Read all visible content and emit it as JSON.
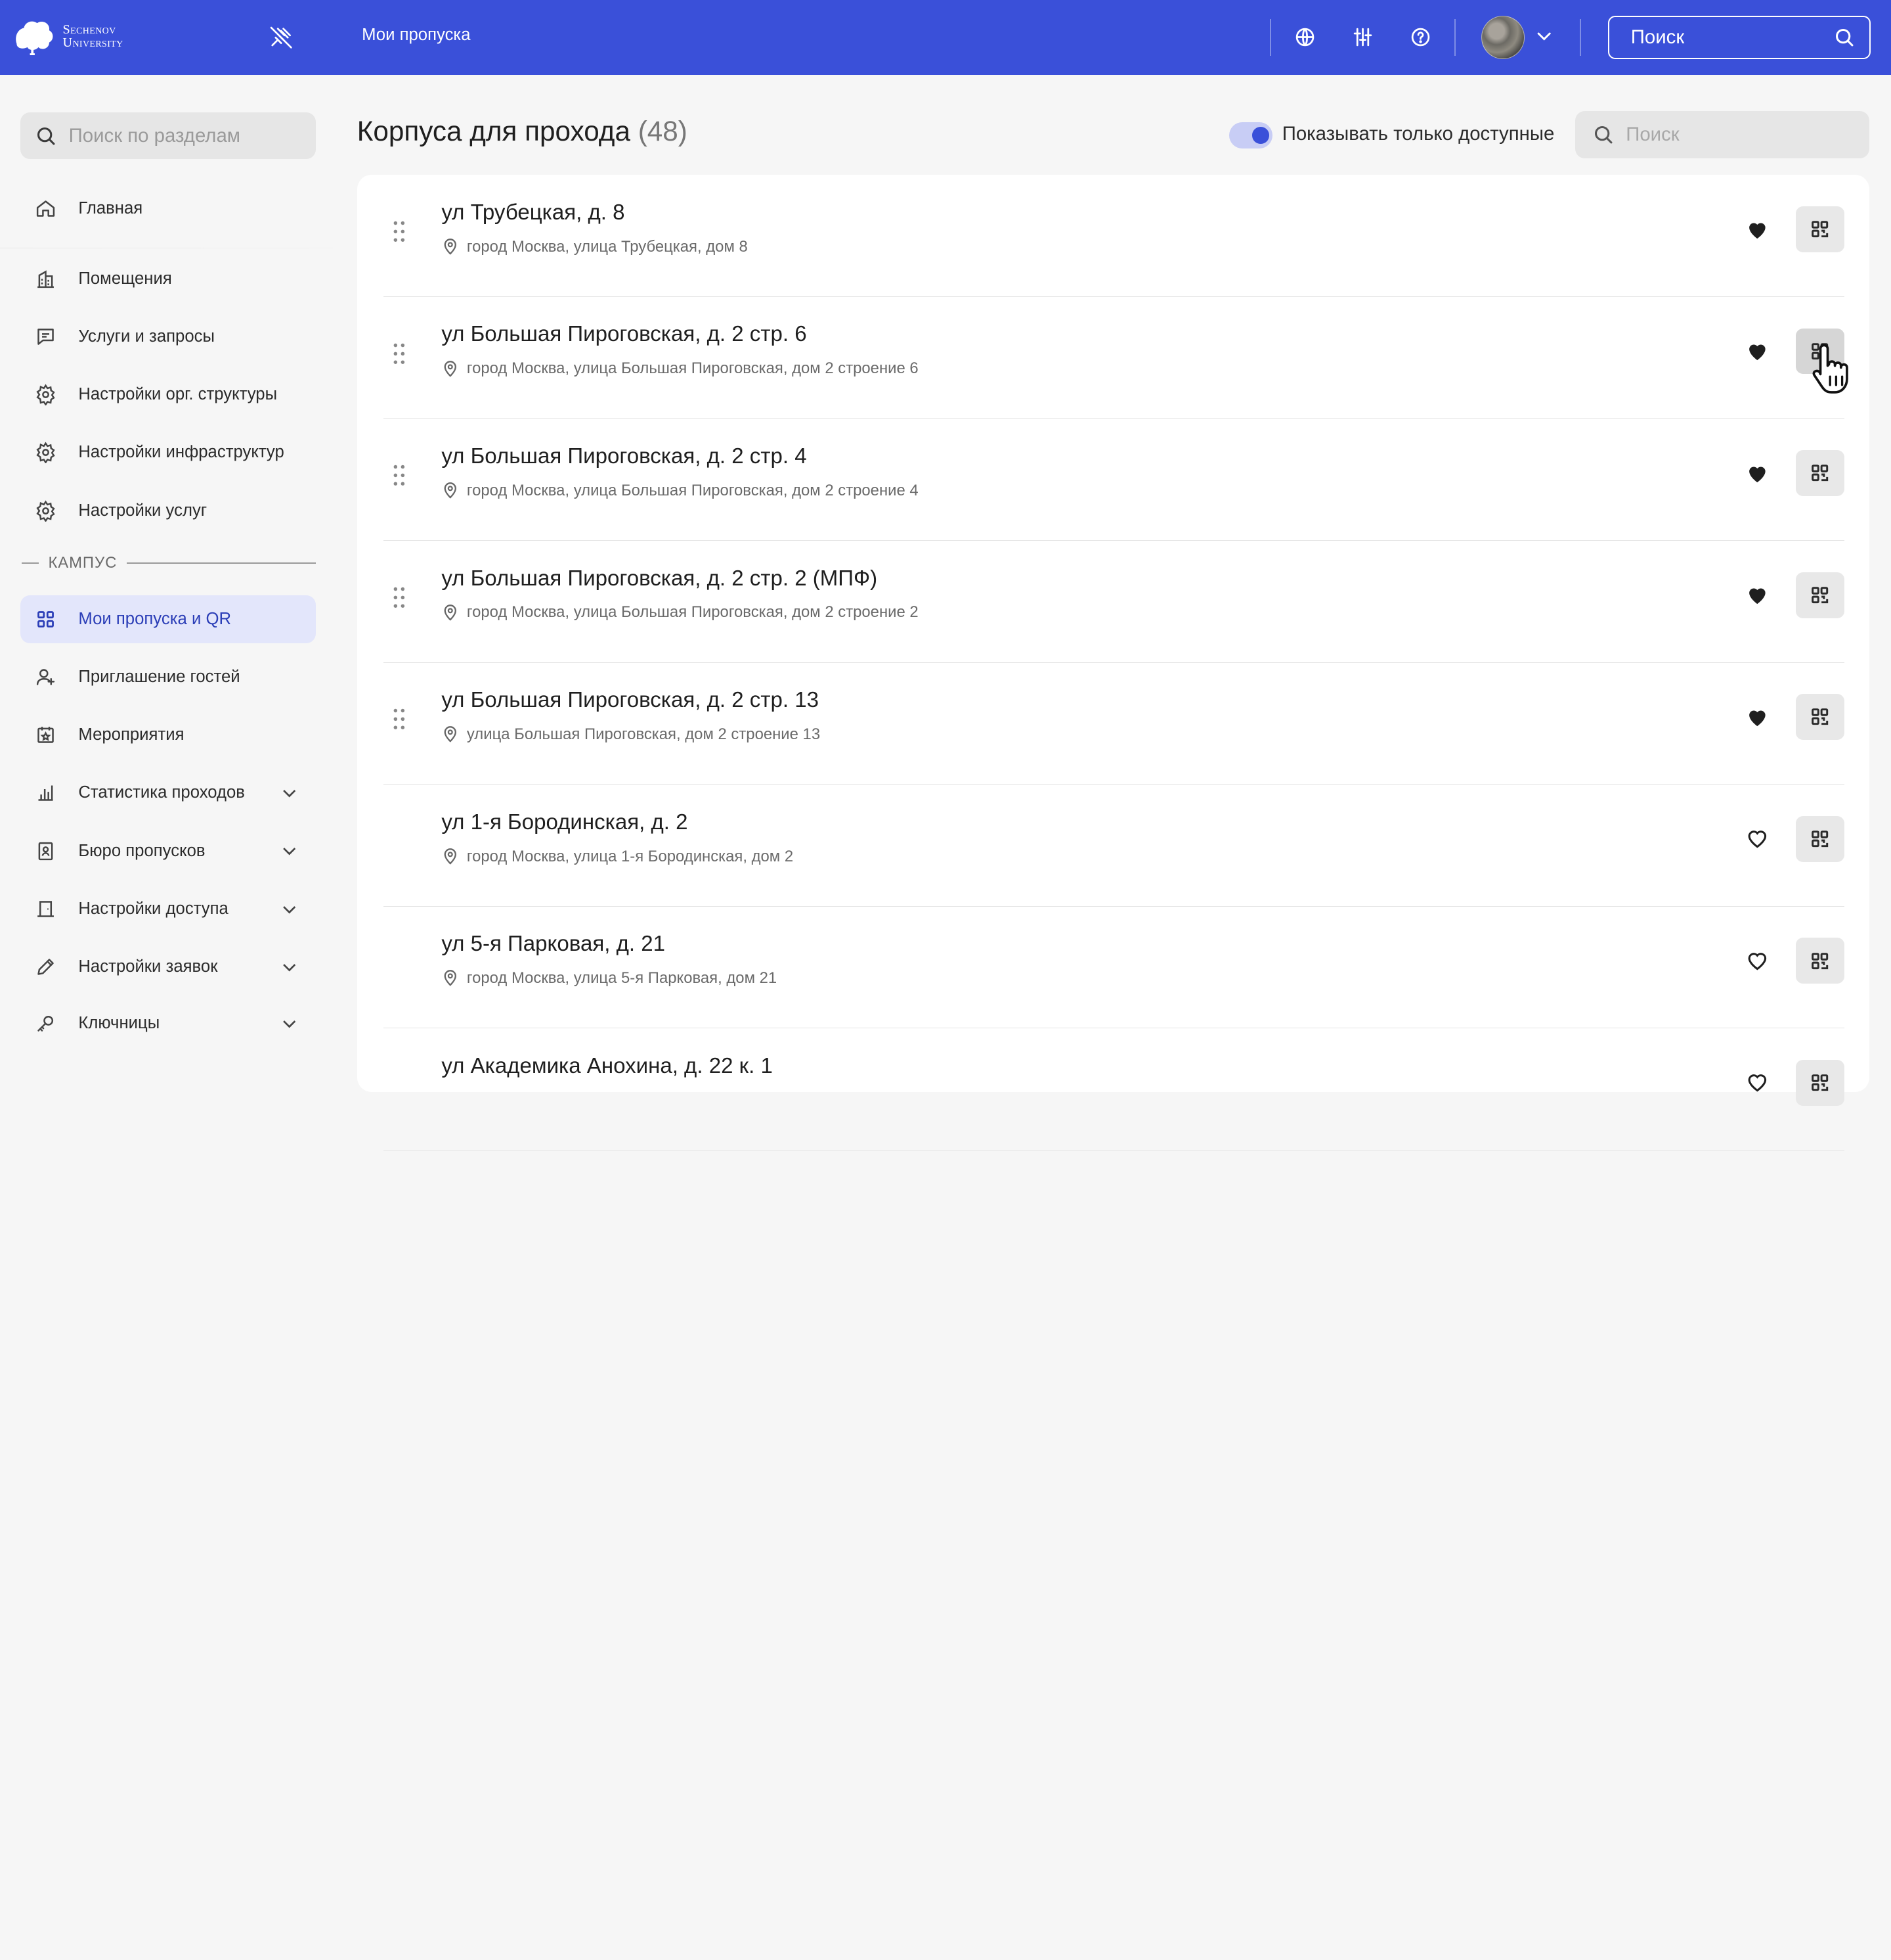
{
  "header": {
    "logo_text_line1": "Sechenov",
    "logo_text_line2": "University",
    "title": "Мои пропуска",
    "search_label": "Поиск"
  },
  "sidebar": {
    "search_placeholder": "Поиск по разделам",
    "items": [
      {
        "label": "Главная",
        "icon": "home-icon"
      },
      {
        "label": "Помещения",
        "icon": "building-icon"
      },
      {
        "label": "Услуги и запросы",
        "icon": "chat-icon"
      },
      {
        "label": "Настройки орг. структуры",
        "icon": "gear-icon"
      },
      {
        "label": "Настройки инфраструктур",
        "icon": "gear-icon"
      },
      {
        "label": "Настройки услуг",
        "icon": "gear-icon"
      }
    ],
    "section_label": "КАМПУС",
    "campus_items": [
      {
        "label": "Мои пропуска и QR",
        "icon": "grid-icon",
        "active": true
      },
      {
        "label": "Приглашение гостей",
        "icon": "user-plus-icon"
      },
      {
        "label": "Мероприятия",
        "icon": "calendar-star-icon"
      },
      {
        "label": "Статистика проходов",
        "icon": "bar-chart-icon",
        "expandable": true
      },
      {
        "label": "Бюро пропусков",
        "icon": "badge-icon",
        "expandable": true
      },
      {
        "label": "Настройки доступа",
        "icon": "door-icon",
        "expandable": true
      },
      {
        "label": "Настройки заявок",
        "icon": "pencil-icon",
        "expandable": true
      },
      {
        "label": "Ключницы",
        "icon": "key-icon",
        "expandable": true
      }
    ]
  },
  "main": {
    "title": "Корпуса для прохода",
    "count": "(48)",
    "toggle_label": "Показывать только доступные",
    "toggle_on": true,
    "search_placeholder": "Поиск",
    "buildings": [
      {
        "title": "ул Трубецкая, д. 8",
        "address": "город Москва, улица Трубецкая, дом 8",
        "favorite": true,
        "draggable": true
      },
      {
        "title": "ул Большая Пироговская, д. 2 стр. 6",
        "address": "город Москва, улица Большая Пироговская, дом 2 строение 6",
        "favorite": true,
        "draggable": true
      },
      {
        "title": "ул Большая Пироговская, д. 2 стр. 4",
        "address": "город Москва, улица Большая Пироговская, дом 2 строение 4",
        "favorite": true,
        "draggable": true
      },
      {
        "title": "ул Большая Пироговская, д. 2 стр. 2 (МПФ)",
        "address": "город Москва, улица Большая Пироговская, дом 2 строение 2",
        "favorite": true,
        "draggable": true
      },
      {
        "title": "ул Большая Пироговская, д. 2 стр. 13",
        "address": "улица Большая Пироговская, дом 2 строение 13",
        "favorite": true,
        "draggable": true
      },
      {
        "title": "ул 1-я Бородинская, д. 2",
        "address": "город Москва, улица 1-я Бородинская, дом 2",
        "favorite": false,
        "draggable": false
      },
      {
        "title": "ул 5-я Парковая, д. 21",
        "address": "город Москва, улица 5-я Парковая, дом 21",
        "favorite": false,
        "draggable": false
      },
      {
        "title": "ул Академика Анохина, д. 22 к. 1",
        "address": "",
        "favorite": false,
        "draggable": false
      }
    ]
  },
  "colors": {
    "brand": "#3a50d9",
    "active_bg": "#e3e6fb",
    "active_text": "#2b3eb7"
  }
}
